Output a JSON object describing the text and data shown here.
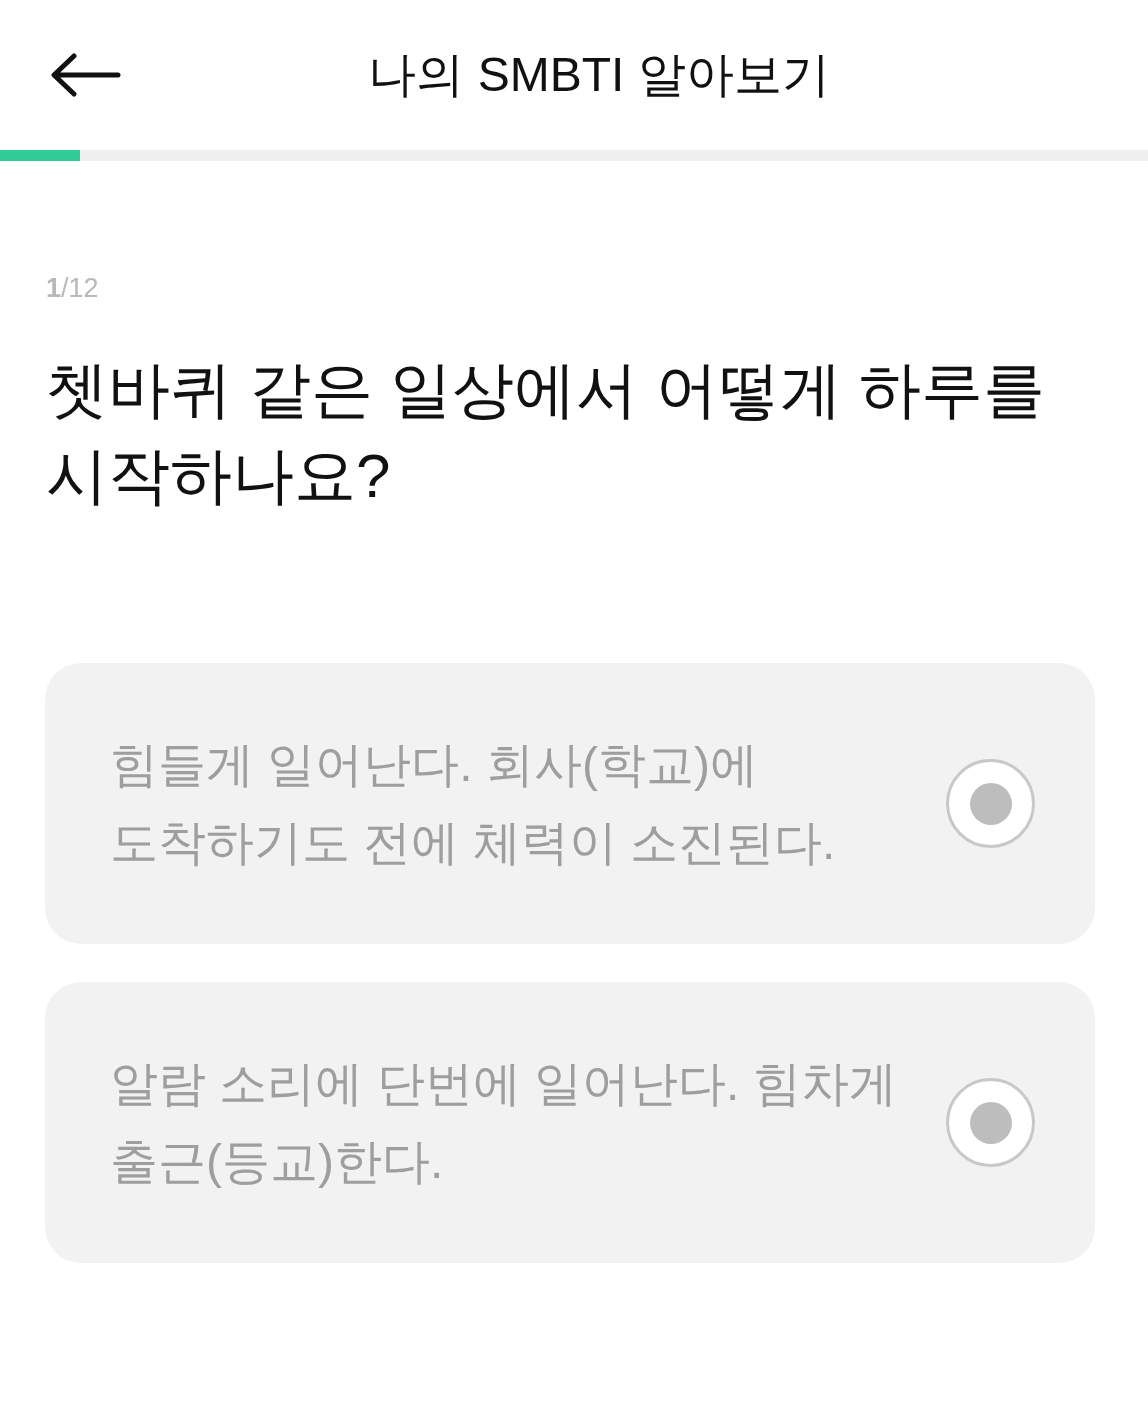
{
  "header": {
    "title": "나의 SMBTI 알아보기"
  },
  "progress": {
    "level": 0.07
  },
  "question": {
    "counter": "**1**/12",
    "text": "쳇바퀴 같은 일상에서 어떻게 하루를 시작하나요?"
  },
  "options": [
    {
      "text": "힘들게 일어난다. 회사(학교)에 도착하기도 전에 체력이 소진된다.",
      "selected": false
    },
    {
      "text": "알람 소리에 단번에 일어난다. 힘차게 출근(등교)한다.",
      "selected": false
    }
  ]
}
